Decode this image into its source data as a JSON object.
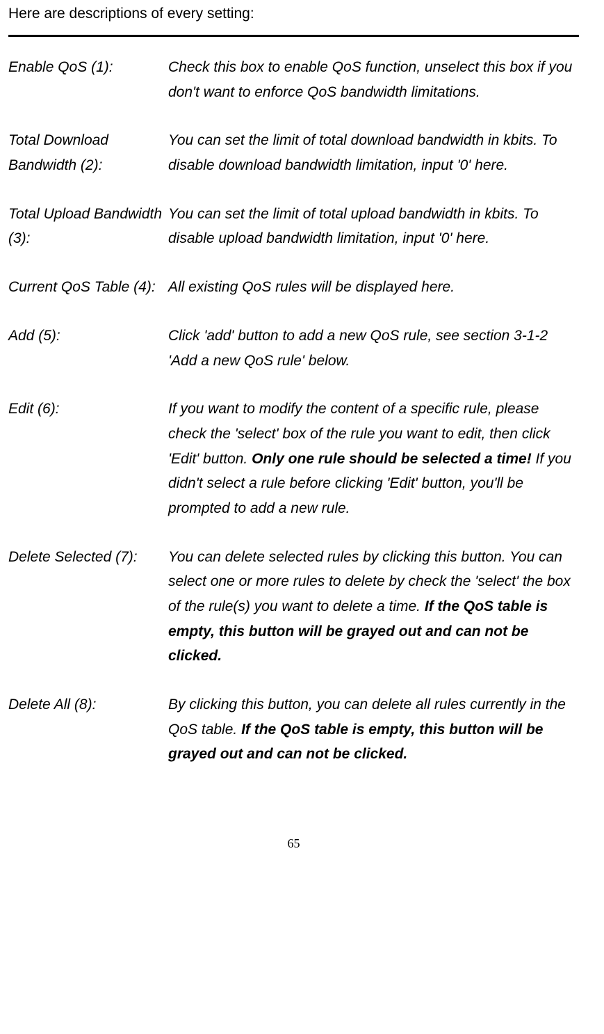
{
  "intro": "Here are descriptions of every setting:",
  "settings": [
    {
      "label": "Enable QoS (1):",
      "desc_pre": "Check this box to enable QoS function, unselect this box if you don't want to enforce QoS bandwidth limitations.",
      "bold": "",
      "desc_post": ""
    },
    {
      "label": "Total Download Bandwidth (2):",
      "desc_pre": "You can set the limit of total download bandwidth in kbits. To disable download bandwidth limitation, input '0' here.",
      "bold": "",
      "desc_post": ""
    },
    {
      "label": "Total Upload Bandwidth (3):",
      "desc_pre": "You can set the limit of total upload bandwidth in kbits. To disable upload bandwidth limitation, input '0' here.",
      "bold": "",
      "desc_post": ""
    },
    {
      "label": "Current QoS Table (4):",
      "desc_pre": "All existing QoS rules will be displayed here.",
      "bold": "",
      "desc_post": ""
    },
    {
      "label": "Add (5):",
      "desc_pre": "Click 'add' button to add a new QoS rule, see section 3-1-2 'Add a new QoS rule' below.",
      "bold": "",
      "desc_post": ""
    },
    {
      "label": "Edit (6):",
      "desc_pre": "If you want to modify the content of a specific rule, please check the 'select' box of the rule you want to edit, then click 'Edit' button. ",
      "bold": "Only one rule should be selected a time!",
      "desc_post": " If you didn't select a rule before clicking 'Edit' button, you'll be prompted to add a new rule."
    },
    {
      "label": "Delete Selected (7):",
      "desc_pre": "You can delete selected rules by clicking this button. You can select one or more rules to delete by check the 'select' the box of the rule(s) you want to delete a time. ",
      "bold": "If the QoS table is empty, this button will be grayed out and can not be clicked.",
      "desc_post": ""
    },
    {
      "label": "Delete All (8):",
      "desc_pre": "By clicking this button, you can delete all rules currently in the QoS table. ",
      "bold": "If the QoS table is empty, this button will be grayed out and can not be clicked.",
      "desc_post": ""
    }
  ],
  "page_number": "65"
}
